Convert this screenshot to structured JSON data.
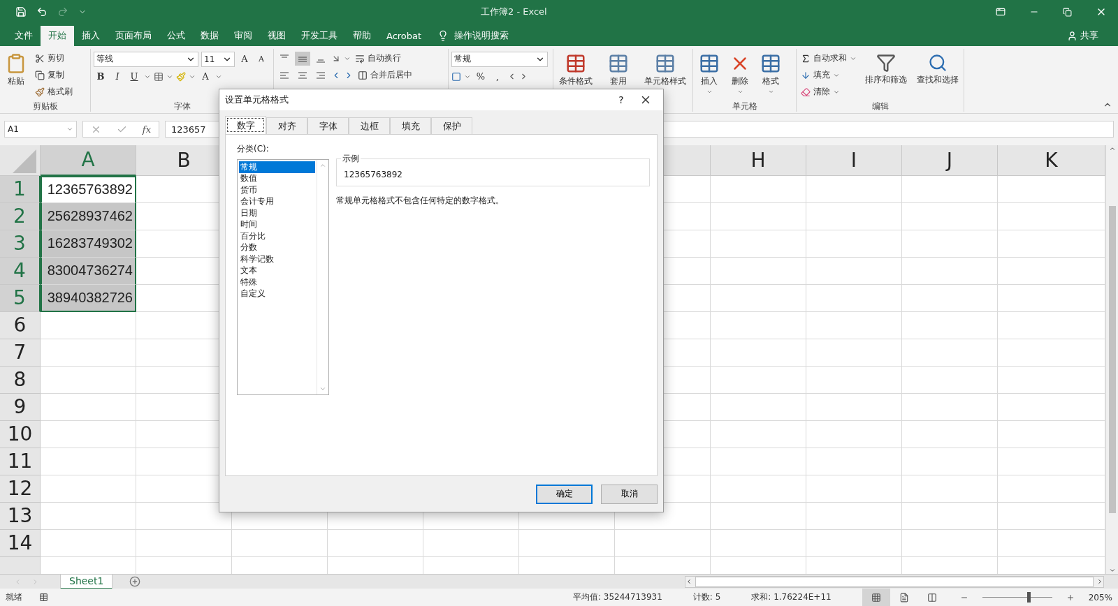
{
  "window": {
    "title": "工作簿2 - Excel"
  },
  "ribbon_tabs": [
    {
      "label": "文件",
      "selected": false
    },
    {
      "label": "开始",
      "selected": true
    },
    {
      "label": "插入",
      "selected": false
    },
    {
      "label": "页面布局",
      "selected": false
    },
    {
      "label": "公式",
      "selected": false
    },
    {
      "label": "数据",
      "selected": false
    },
    {
      "label": "审阅",
      "selected": false
    },
    {
      "label": "视图",
      "selected": false
    },
    {
      "label": "开发工具",
      "selected": false
    },
    {
      "label": "帮助",
      "selected": false
    },
    {
      "label": "Acrobat",
      "selected": false
    }
  ],
  "tell_me": "操作说明搜索",
  "share": "共享",
  "clipboard": {
    "paste": "粘贴",
    "cut": "剪切",
    "copy": "复制",
    "format_painter": "格式刷",
    "group_label": "剪贴板"
  },
  "font": {
    "name": "等线",
    "size": "11",
    "grow": "A",
    "shrink": "A",
    "bold": "B",
    "italic": "I",
    "underline": "U",
    "color_button": "A",
    "group_label": "字体"
  },
  "alignment": {
    "wrap_text": "自动换行",
    "merge": "合并后居中"
  },
  "number": {
    "format": "常规",
    "percent": "%",
    "comma": ","
  },
  "styles": [
    "条件格式",
    "套用",
    "单元格样式"
  ],
  "cells": {
    "buttons": [
      "插入",
      "删除",
      "格式"
    ],
    "group_label": "单元格"
  },
  "editing": {
    "autosum": "自动求和",
    "fill": "填充",
    "clear": "清除",
    "sort": "排序和筛选",
    "find": "查找和选择",
    "group_label": "编辑"
  },
  "formula_bar": {
    "name_box": "A1",
    "function_label": "fx",
    "formula": "123657"
  },
  "columns_left": [
    {
      "label": "A",
      "selected": true
    },
    {
      "label": "B",
      "selected": false
    }
  ],
  "columns_right": [
    {
      "label": "H",
      "selected": false
    },
    {
      "label": "I",
      "selected": false
    },
    {
      "label": "J",
      "selected": false
    },
    {
      "label": "K",
      "selected": false
    }
  ],
  "rows": [
    {
      "label": "1",
      "value": "12365763892",
      "selected": true,
      "active": true
    },
    {
      "label": "2",
      "value": "25628937462",
      "selected": true,
      "active": false
    },
    {
      "label": "3",
      "value": "16283749302",
      "selected": true,
      "active": false
    },
    {
      "label": "4",
      "value": "83004736274",
      "selected": true,
      "active": false
    },
    {
      "label": "5",
      "value": "38940382726",
      "selected": true,
      "active": false
    },
    {
      "label": "6",
      "selected": false
    },
    {
      "label": "7",
      "selected": false
    },
    {
      "label": "8",
      "selected": false
    },
    {
      "label": "9",
      "selected": false
    },
    {
      "label": "10",
      "selected": false
    },
    {
      "label": "11",
      "selected": false
    },
    {
      "label": "12",
      "selected": false
    },
    {
      "label": "13",
      "selected": false
    },
    {
      "label": "14",
      "selected": false
    }
  ],
  "sheets": [
    {
      "label": "Sheet1",
      "selected": true
    }
  ],
  "status_bar": {
    "ready": "就绪",
    "average": "平均值: 35244713931",
    "count": "计数: 5",
    "sum": "求和: 1.76224E+11",
    "views": [
      {
        "kind": "normal",
        "selected": true
      },
      {
        "kind": "page_layout",
        "selected": false
      },
      {
        "kind": "page_break",
        "selected": false
      }
    ],
    "zoom": {
      "level": 0.66,
      "reading": "205%"
    }
  },
  "dialog": {
    "title": "设置单元格格式",
    "help": "?",
    "tabs": [
      {
        "label": "数字",
        "selected": true
      },
      {
        "label": "对齐",
        "selected": false
      },
      {
        "label": "字体",
        "selected": false
      },
      {
        "label": "边框",
        "selected": false
      },
      {
        "label": "填充",
        "selected": false
      },
      {
        "label": "保护",
        "selected": false
      }
    ],
    "category_label": "分类(C):",
    "categories": [
      {
        "label": "常规",
        "selected": true
      },
      {
        "label": "数值",
        "selected": false
      },
      {
        "label": "货币",
        "selected": false
      },
      {
        "label": "会计专用",
        "selected": false
      },
      {
        "label": "日期",
        "selected": false
      },
      {
        "label": "时间",
        "selected": false
      },
      {
        "label": "百分比",
        "selected": false
      },
      {
        "label": "分数",
        "selected": false
      },
      {
        "label": "科学记数",
        "selected": false
      },
      {
        "label": "文本",
        "selected": false
      },
      {
        "label": "特殊",
        "selected": false
      },
      {
        "label": "自定义",
        "selected": false
      }
    ],
    "sample_label": "示例",
    "sample_value": "12365763892",
    "description": "常规单元格格式不包含任何特定的数字格式。",
    "buttons": [
      {
        "label": "确定",
        "kind": "default"
      },
      {
        "label": "取消",
        "kind": "normal"
      }
    ]
  }
}
